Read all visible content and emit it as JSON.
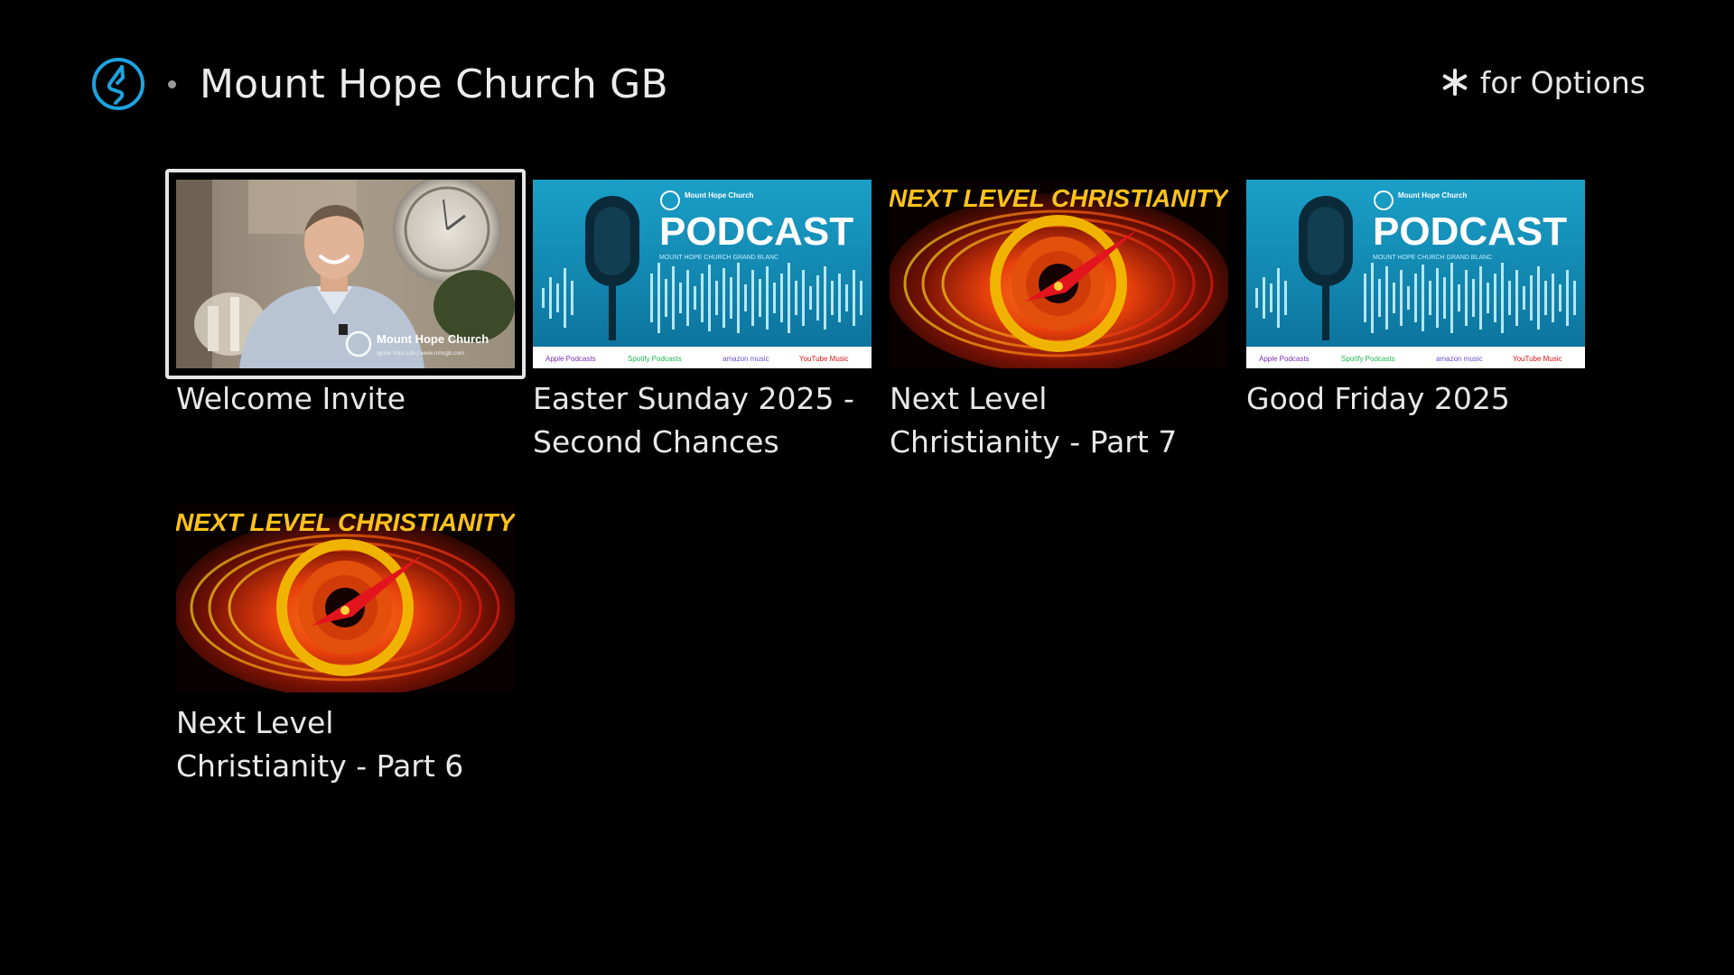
{
  "header": {
    "channel_icon": "channel-logo-icon",
    "title": "Mount Hope Church GB",
    "options_icon": "asterisk-icon",
    "options_text": "for Options"
  },
  "colors": {
    "background": "#000000",
    "focus_ring": "#e6e6e6",
    "text": "#e8e8e8",
    "logo_accent": "#1da3e0"
  },
  "videos": [
    {
      "title": "Welcome Invite",
      "thumbnail": "welcome-video-thumbnail",
      "thumb_text": "Mount Hope Church",
      "thumb_subtext": "Ignite Your Life | www.mhcgb.com",
      "focused": true
    },
    {
      "title": "Easter Sunday 2025 - Second Chances",
      "thumbnail": "podcast-thumbnail",
      "thumb_text": "PODCAST",
      "thumb_subtext": "MOUNT HOPE CHURCH GRAND BLANC",
      "thumb_brand": "Mount Hope Church",
      "platforms": [
        "Apple Podcasts",
        "Spotify Podcasts",
        "amazon music",
        "YouTube Music"
      ]
    },
    {
      "title": "Next Level Christianity - Part 7",
      "thumbnail": "next-level-christianity-thumbnail",
      "thumb_text": "NEXT LEVEL CHRISTIANITY"
    },
    {
      "title": "Good Friday 2025",
      "thumbnail": "podcast-thumbnail",
      "thumb_text": "PODCAST",
      "thumb_subtext": "MOUNT HOPE CHURCH GRAND BLANC",
      "thumb_brand": "Mount Hope Church",
      "platforms": [
        "Apple Podcasts",
        "Spotify Podcasts",
        "amazon music",
        "YouTube Music"
      ]
    },
    {
      "title": "Next Level Christianity - Part 6",
      "thumbnail": "next-level-christianity-thumbnail",
      "thumb_text": "NEXT LEVEL CHRISTIANITY"
    }
  ]
}
